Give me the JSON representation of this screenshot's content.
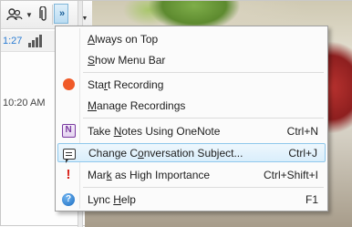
{
  "background": {
    "status_time": "1:27",
    "message_time": "10:20 AM"
  },
  "toolbar": {
    "participants_icon": "participants-icon",
    "attach_icon": "paperclip-icon",
    "overflow_icon": "double-chevron-icon",
    "overflow_label": "»"
  },
  "menu": {
    "items": [
      {
        "label_pre": "",
        "label_accel": "A",
        "label_post": "lways on Top",
        "shortcut": "",
        "icon": ""
      },
      {
        "label_pre": "",
        "label_accel": "S",
        "label_post": "how Menu Bar",
        "shortcut": "",
        "icon": ""
      },
      {
        "label_pre": "Sta",
        "label_accel": "r",
        "label_post": "t Recording",
        "shortcut": "",
        "icon": "record-icon"
      },
      {
        "label_pre": "",
        "label_accel": "M",
        "label_post": "anage Recordings",
        "shortcut": "",
        "icon": ""
      },
      {
        "label_pre": "Take ",
        "label_accel": "N",
        "label_post": "otes Using OneNote",
        "shortcut": "Ctrl+N",
        "icon": "onenote-icon"
      },
      {
        "label_pre": "Change C",
        "label_accel": "o",
        "label_post": "nversation Subject...",
        "shortcut": "Ctrl+J",
        "icon": "conversation-subject-icon"
      },
      {
        "label_pre": "Mar",
        "label_accel": "k",
        "label_post": " as High Importance",
        "shortcut": "Ctrl+Shift+I",
        "icon": "exclamation-icon"
      },
      {
        "label_pre": "Lync ",
        "label_accel": "H",
        "label_post": "elp",
        "shortcut": "F1",
        "icon": "help-icon"
      }
    ],
    "selected_index": 5
  },
  "colors": {
    "selection_border": "#8fc8ec",
    "record": "#f05a28",
    "importance": "#d8251d",
    "help": "#1e6fc2"
  }
}
